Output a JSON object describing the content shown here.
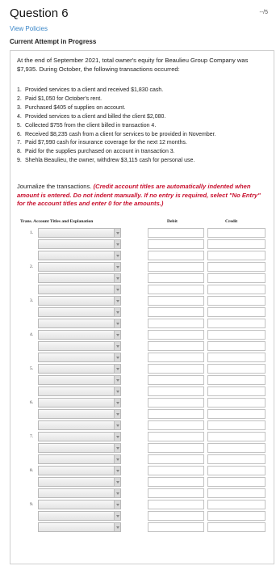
{
  "question": {
    "title": "Question 6",
    "points": "--/5",
    "view_policies": "View Policies",
    "attempt_status": "Current Attempt in Progress"
  },
  "problem": {
    "intro": "At the end of September 2021, total owner's equity for Beaulieu Group Company was $7,935. During October, the following transactions occurred:",
    "transactions": [
      {
        "num": "1.",
        "text": "Provided services to a client and received $1,830 cash."
      },
      {
        "num": "2.",
        "text": "Paid $1,050 for October's rent."
      },
      {
        "num": "3.",
        "text": "Purchased $405 of supplies on account."
      },
      {
        "num": "4.",
        "text": "Provided services to a client and billed the client $2,080."
      },
      {
        "num": "5.",
        "text": "Collected $755 from the client billed in transaction 4."
      },
      {
        "num": "6.",
        "text": "Received $8,235 cash from a client for services to be provided in November."
      },
      {
        "num": "7.",
        "text": "Paid $7,990 cash for insurance coverage for the next 12 months."
      },
      {
        "num": "8.",
        "text": "Paid for the supplies purchased on account in transaction 3."
      },
      {
        "num": "9.",
        "text": "Shehla Beaulieu, the owner, withdrew $3,115 cash for personal use."
      }
    ],
    "instruction_plain": "Journalize the transactions. ",
    "instruction_red": "(Credit account titles are automatically indented when amount is entered. Do not indent manually. If no entry is required, select \"No Entry\" for the account titles and enter 0 for the amounts.)"
  },
  "journal": {
    "headers": {
      "account": "Trans. Account Titles and Explanation",
      "debit": "Debit",
      "credit": "Credit"
    },
    "entry_labels": [
      "1.",
      "2.",
      "3.",
      "4.",
      "5.",
      "6.",
      "7.",
      "8.",
      "9."
    ]
  }
}
